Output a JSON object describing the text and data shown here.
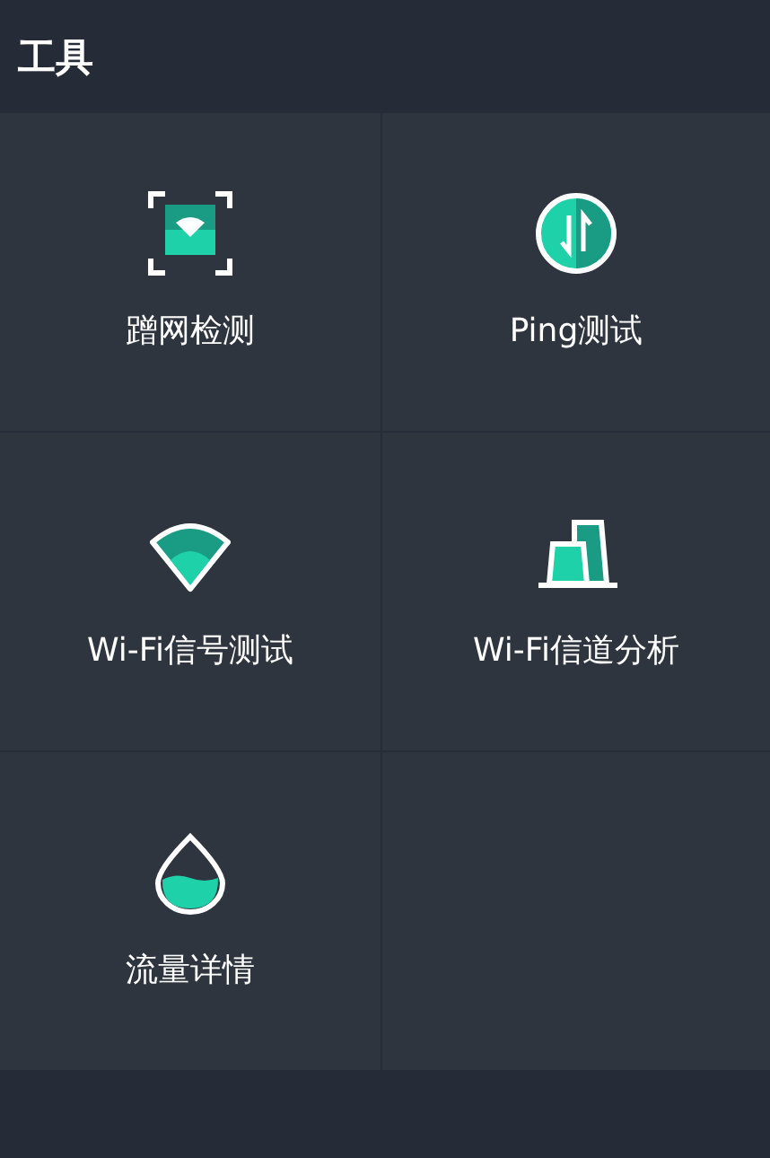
{
  "header": {
    "title": "工具"
  },
  "tools": [
    {
      "label": "蹭网检测",
      "kind": "scan"
    },
    {
      "label": "Ping测试",
      "kind": "ping"
    },
    {
      "label": "Wi-Fi信号测试",
      "kind": "signal"
    },
    {
      "label": "Wi-Fi信道分析",
      "kind": "channel"
    },
    {
      "label": "流量详情",
      "kind": "traffic"
    }
  ]
}
